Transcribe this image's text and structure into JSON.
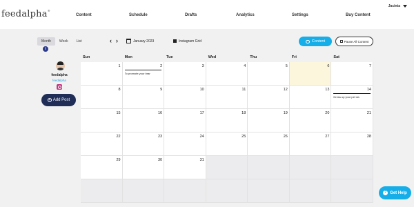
{
  "app": {
    "logo": "feedalpha",
    "logo_mark": "®"
  },
  "nav": {
    "items": [
      "Content",
      "Schedule",
      "Drafts",
      "Analytics",
      "Settings",
      "Buy Content"
    ],
    "user": "Jacinta"
  },
  "toolbar": {
    "view_tabs": [
      "Month",
      "Week",
      "List"
    ],
    "active_view": "Month",
    "info": "i",
    "prev": "‹",
    "next": "›",
    "month": "January 2023",
    "grid_view": "Instagram Grid",
    "content_button": "Content",
    "pause_button": "Pause All Content"
  },
  "profile": {
    "name": "feedalpha",
    "handle": "feedalpha",
    "add_post": "Add Post"
  },
  "calendar": {
    "weekdays": [
      "Sun",
      "Mon",
      "Tue",
      "Wed",
      "Thu",
      "Fri",
      "Sat"
    ],
    "weeks": [
      [
        {
          "d": ""
        },
        {
          "d": "1"
        },
        {
          "d": "2",
          "post": "To promote your brar"
        },
        {
          "d": "3"
        },
        {
          "d": "4"
        },
        {
          "d": "5"
        },
        {
          "d": "6",
          "today": true
        },
        {
          "d": "7"
        }
      ],
      [
        {
          "d": "8"
        },
        {
          "d": "9"
        },
        {
          "d": "10"
        },
        {
          "d": "11"
        },
        {
          "d": "12"
        },
        {
          "d": "13"
        },
        {
          "d": "14",
          "post": "Dress up your pet da"
        }
      ],
      [
        {
          "d": "15"
        },
        {
          "d": "16"
        },
        {
          "d": "17"
        },
        {
          "d": "18"
        },
        {
          "d": "19"
        },
        {
          "d": "20"
        },
        {
          "d": "21"
        }
      ],
      [
        {
          "d": "22"
        },
        {
          "d": "23"
        },
        {
          "d": "24"
        },
        {
          "d": "25"
        },
        {
          "d": "26"
        },
        {
          "d": "27"
        },
        {
          "d": "28"
        }
      ],
      [
        {
          "d": "29"
        },
        {
          "d": "30"
        },
        {
          "d": "31"
        },
        {
          "d": "",
          "muted": true
        },
        {
          "d": "",
          "muted": true
        },
        {
          "d": "",
          "muted": true
        },
        {
          "d": "",
          "muted": true
        }
      ],
      [
        {
          "d": "",
          "muted": true
        },
        {
          "d": "",
          "muted": true
        },
        {
          "d": "",
          "muted": true
        },
        {
          "d": "",
          "muted": true
        },
        {
          "d": "",
          "muted": true
        },
        {
          "d": "",
          "muted": true
        },
        {
          "d": "",
          "muted": true
        }
      ]
    ]
  },
  "help": {
    "label": "Get Help"
  },
  "colors": {
    "accent": "#16aee8",
    "navy": "#1f2d57",
    "today": "#fbf6dc"
  }
}
